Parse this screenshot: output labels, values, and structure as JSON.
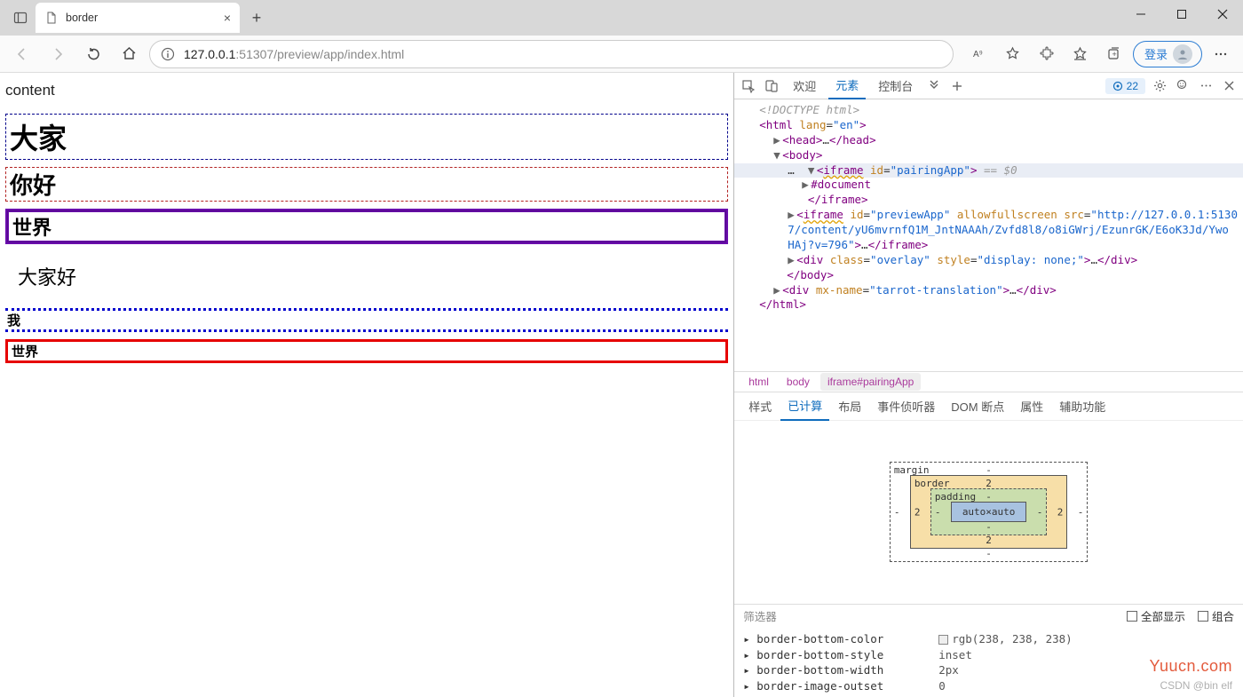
{
  "browser": {
    "tab_title": "border",
    "new_tab_tooltip": "+",
    "url_ip": "127.0.0.1",
    "url_port": ":51307",
    "url_path": "/preview/app/index.html",
    "login_label": "登录"
  },
  "page": {
    "content_label": "content",
    "r1": "大家",
    "r2": "你好",
    "r3": "世界",
    "r4": "大家好",
    "r5": "我",
    "r6": "世界"
  },
  "devtools": {
    "tabs": {
      "welcome": "欢迎",
      "elements": "元素",
      "console": "控制台"
    },
    "issues_count": "22",
    "dom": {
      "doctype": "<!DOCTYPE html>",
      "html_open": "<html lang=\"en\">",
      "head": "<head>…</head>",
      "body_open": "<body>",
      "iframe1_open": "<iframe id=\"pairingApp\">",
      "iframe1_hint": " == $0",
      "iframe1_doc": "#document",
      "iframe1_close": "</iframe>",
      "iframe2": "<iframe id=\"previewApp\" allowfullscreen src=\"http://127.0.0.1:51307/content/yU6mvrnfQ1M_JntNAAAh/Zvfd8l8/o8iGWrj/EzunrGK/E6oK3Jd/YwoHAj?v=796\">…</iframe>",
      "overlay": "<div class=\"overlay\" style=\"display: none;\">…</div>",
      "body_close": "</body>",
      "tarrot": "<div mx-name=\"tarrot-translation\">…</div>",
      "html_close": "</html>"
    },
    "crumbs": {
      "html": "html",
      "body": "body",
      "iframe": "iframe#pairingApp"
    },
    "panel_tabs": {
      "styles": "样式",
      "computed": "已计算",
      "layout": "布局",
      "event": "事件侦听器",
      "dom_bp": "DOM 断点",
      "props": "属性",
      "a11y": "辅助功能"
    },
    "box_model": {
      "margin_label": "margin",
      "border_label": "border",
      "padding_label": "padding",
      "content": "auto×auto",
      "margin": {
        "top": "-",
        "right": "-",
        "bottom": "-",
        "left": "-"
      },
      "border": {
        "top": "2",
        "right": "2",
        "bottom": "2",
        "left": "2"
      },
      "padding": {
        "top": "-",
        "right": "-",
        "bottom": "-",
        "left": "-"
      }
    },
    "filter": {
      "label": "筛选器",
      "show_all": "全部显示",
      "group": "组合"
    },
    "computed_props": [
      {
        "name": "border-bottom-color",
        "value": "rgb(238, 238, 238)",
        "swatch": true
      },
      {
        "name": "border-bottom-style",
        "value": "inset"
      },
      {
        "name": "border-bottom-width",
        "value": "2px"
      },
      {
        "name": "border-image-outset",
        "value": "0"
      }
    ]
  },
  "watermark": {
    "site": "Yuucn.com",
    "author": "CSDN @bin elf"
  }
}
